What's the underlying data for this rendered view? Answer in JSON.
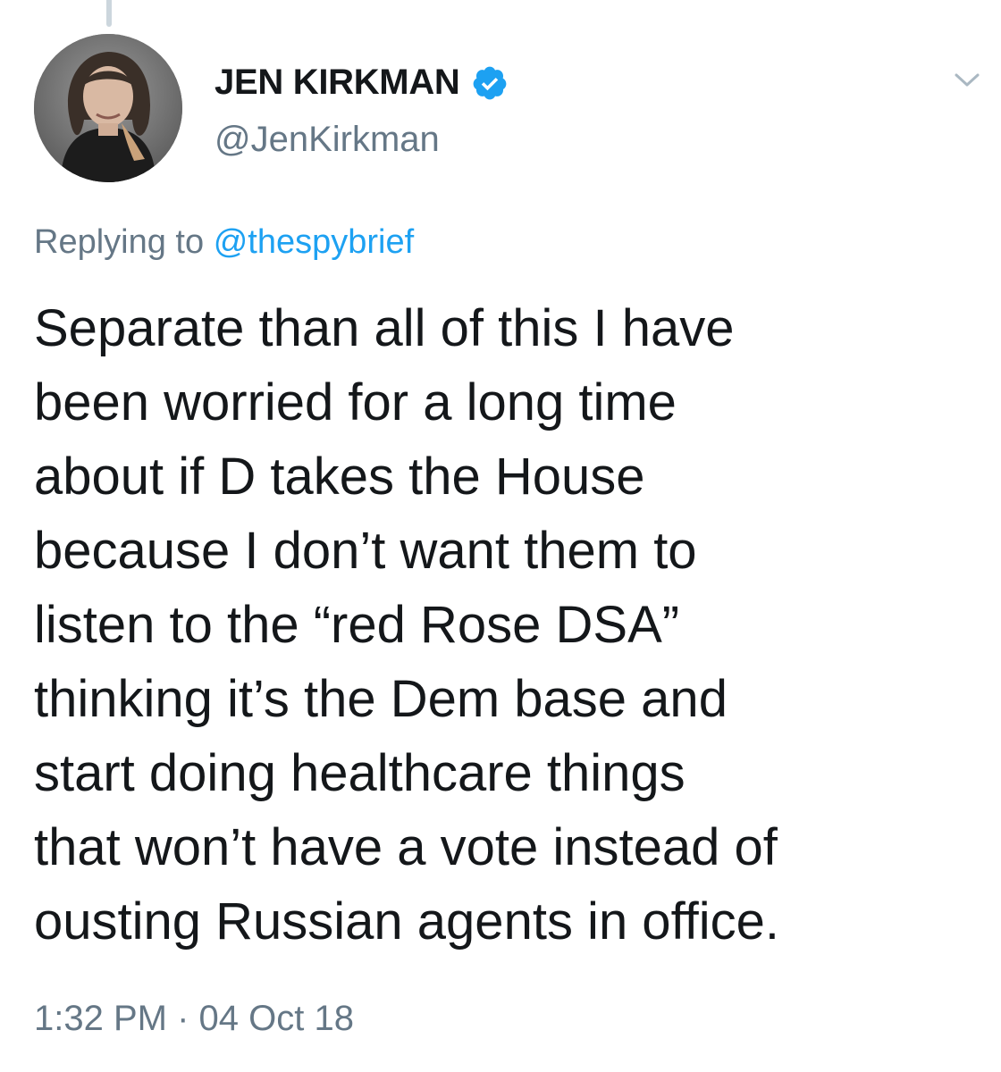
{
  "tweet": {
    "author": {
      "display_name": "JEN KIRKMAN",
      "handle": "@JenKirkman",
      "verified": true,
      "avatar_icon": "profile-photo"
    },
    "reply_context": {
      "prefix": "Replying to",
      "mention": "@thespybrief"
    },
    "text_lines": [
      "Separate than all of this I have",
      "been worried for a long time",
      "about if D takes the House",
      "because I don’t want them to",
      "listen to the “red Rose DSA”",
      "thinking it’s the Dem base and",
      "start doing healthcare things",
      "that won’t have a vote instead of",
      "ousting Russian agents in office."
    ],
    "timestamp": {
      "time": "1:32 PM",
      "separator": "·",
      "date": "04 Oct 18"
    },
    "menu_icon": "chevron-down-icon"
  },
  "colors": {
    "text": "#14171a",
    "secondary": "#657786",
    "link": "#1da1f2",
    "verified_badge": "#1da1f2",
    "thread_line": "#ccd6dd"
  }
}
